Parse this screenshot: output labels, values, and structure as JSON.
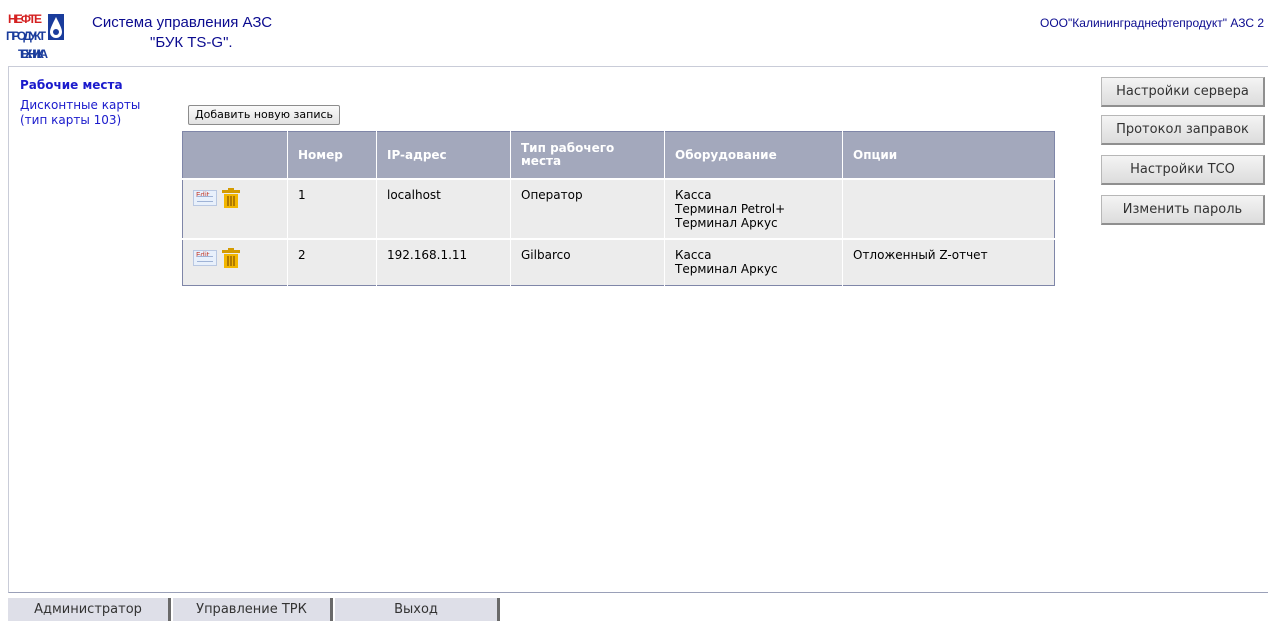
{
  "header": {
    "title_line1": "Система управления АЗС",
    "title_line2": "\"БУК TS-G\".",
    "company": "ООО\"Калининграднефтепродукт\" АЗС 2",
    "logo_text": [
      "НЕФТЕ",
      "ПРОДУКТ",
      "ТЕХНИКА"
    ]
  },
  "nav": {
    "title": "Рабочие места",
    "link": "Дисконтные карты (тип карты 103)"
  },
  "toolbar": {
    "add_label": "Добавить новую запись"
  },
  "table": {
    "columns": [
      "",
      "Номер",
      "IP-адрес",
      "Тип рабочего места",
      "Оборудование",
      "Опции"
    ],
    "rows": [
      {
        "number": "1",
        "ip": "localhost",
        "type": "Оператор",
        "equipment": [
          "Касса",
          "Терминал Petrol+",
          "Терминал Аркус"
        ],
        "options": ""
      },
      {
        "number": "2",
        "ip": "192.168.1.11",
        "type": "Gilbarco",
        "equipment": [
          "Касса",
          "Терминал Аркус"
        ],
        "options": "Отложенный Z-отчет"
      }
    ],
    "edit_icon_text": "Edit"
  },
  "side_buttons": [
    "Настройки сервера",
    "Протокол заправок",
    "Настройки ТСО",
    "Изменить пароль"
  ],
  "tabs": [
    "Администратор",
    "Управление ТРК",
    "Выход"
  ],
  "colors": {
    "header_bg": "#a3a8bc",
    "link": "#1a1acc",
    "title": "#0b0b8f",
    "logo_red": "#d42020",
    "logo_blue": "#1a3c9c"
  },
  "icons": {
    "edit": "edit-icon",
    "delete": "trash-icon"
  }
}
